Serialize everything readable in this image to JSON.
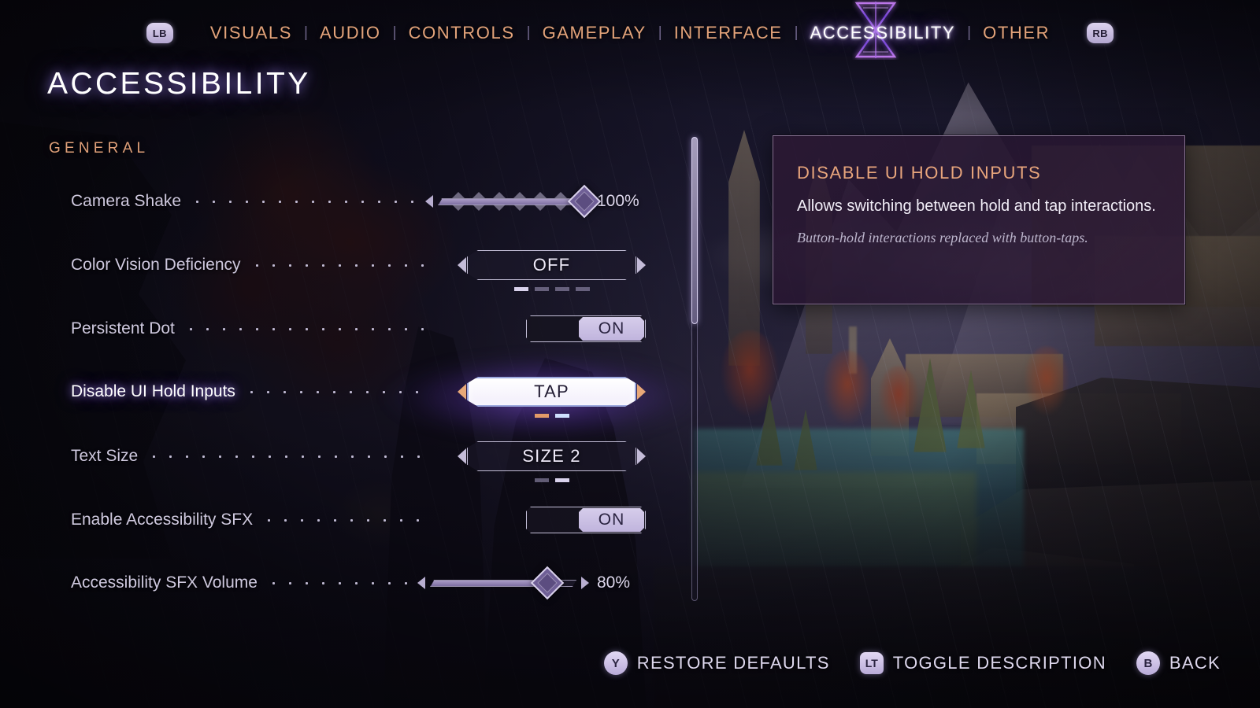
{
  "topbar": {
    "left_bumper": "LB",
    "right_bumper": "RB",
    "separator": "|",
    "tabs": [
      {
        "label": "VISUALS",
        "active": false
      },
      {
        "label": "AUDIO",
        "active": false
      },
      {
        "label": "CONTROLS",
        "active": false
      },
      {
        "label": "GAMEPLAY",
        "active": false
      },
      {
        "label": "INTERFACE",
        "active": false
      },
      {
        "label": "ACCESSIBILITY",
        "active": true
      },
      {
        "label": "OTHER",
        "active": false
      }
    ]
  },
  "page": {
    "title": "ACCESSIBILITY",
    "section": "GENERAL"
  },
  "settings": [
    {
      "label": "Camera Shake",
      "type": "slider",
      "value": "100%",
      "fill_percent": 100,
      "selected": false
    },
    {
      "label": "Color Vision Deficiency",
      "type": "selector",
      "value": "OFF",
      "option_count": 4,
      "option_index": 0,
      "selected": false
    },
    {
      "label": "Persistent Dot",
      "type": "toggle",
      "value": "ON",
      "selected": false
    },
    {
      "label": "Disable UI Hold Inputs",
      "type": "selector",
      "value": "TAP",
      "option_count": 2,
      "option_index": 0,
      "selected": true
    },
    {
      "label": "Text Size",
      "type": "selector",
      "value": "SIZE 2",
      "option_count": 2,
      "option_index": 1,
      "selected": false
    },
    {
      "label": "Enable Accessibility SFX",
      "type": "toggle",
      "value": "ON",
      "selected": false
    },
    {
      "label": "Accessibility SFX Volume",
      "type": "slider",
      "value": "80%",
      "fill_percent": 80,
      "selected": false
    }
  ],
  "description": {
    "title": "DISABLE UI HOLD INPUTS",
    "body": "Allows switching between hold and tap interactions.",
    "note": "Button-hold interactions replaced with button-taps."
  },
  "footer": [
    {
      "button": "Y",
      "shape": "circle",
      "label": "RESTORE DEFAULTS"
    },
    {
      "button": "LT",
      "shape": "trigger",
      "label": "TOGGLE DESCRIPTION"
    },
    {
      "button": "B",
      "shape": "circle",
      "label": "BACK"
    }
  ],
  "colors": {
    "accent_orange": "#e3a37a",
    "active_tab": "#ffffff",
    "label_text": "#cfc9df",
    "selection_glow": "#7e4ed8",
    "panel_bg": "#2c1834",
    "control_light": "#d6cdeb"
  }
}
